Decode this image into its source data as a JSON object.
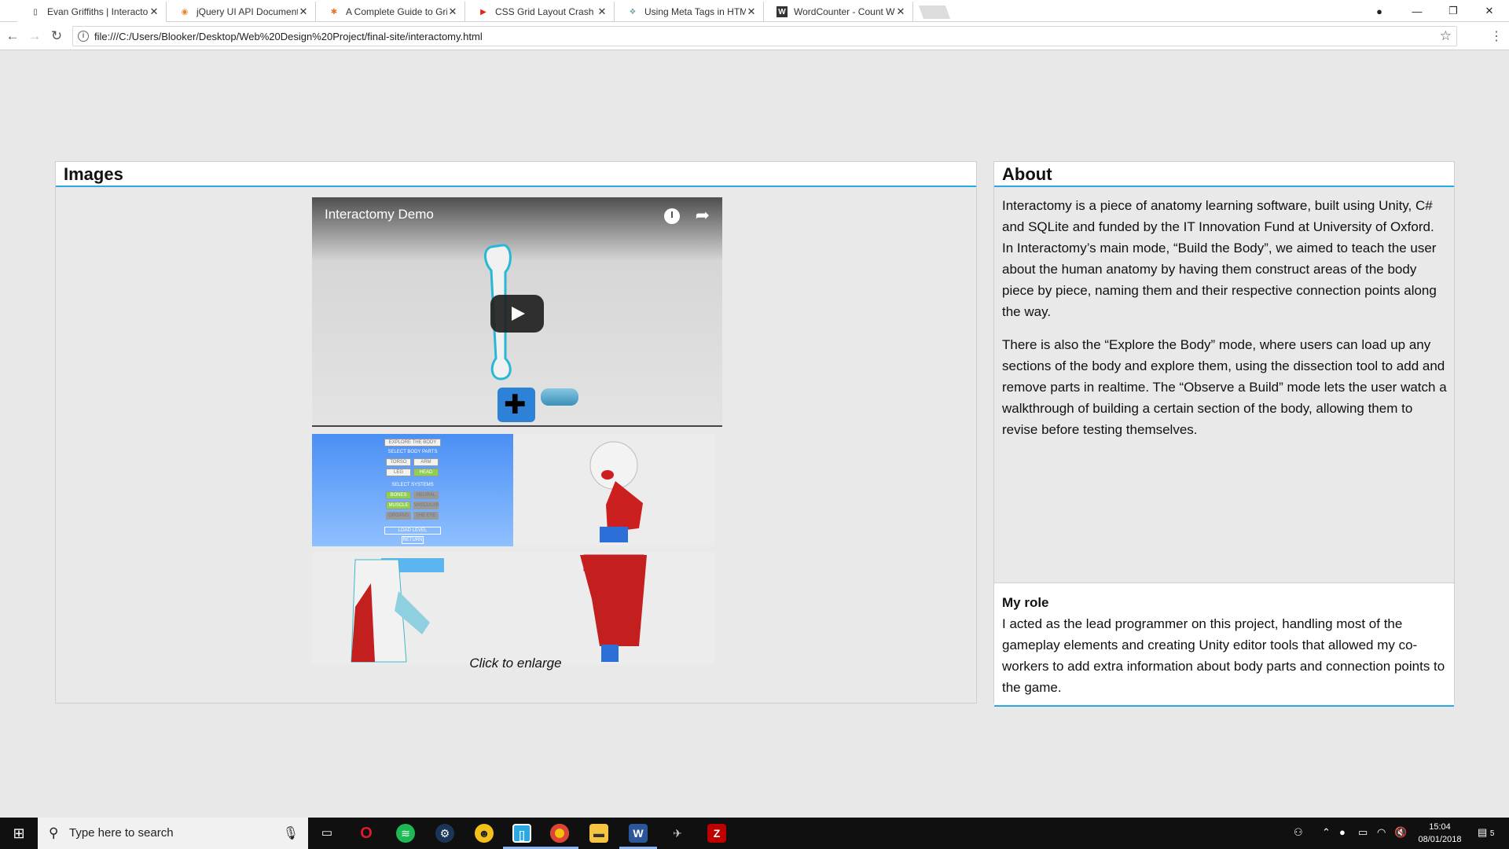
{
  "browser": {
    "tabs": [
      {
        "title": "Evan Griffiths | Interacto",
        "icon": "document-icon",
        "active": true
      },
      {
        "title": "jQuery UI API Document",
        "icon": "jquery-icon",
        "active": false
      },
      {
        "title": "A Complete Guide to Gri",
        "icon": "css-tricks-icon",
        "active": false
      },
      {
        "title": "CSS Grid Layout Crash C",
        "icon": "youtube-icon",
        "active": false
      },
      {
        "title": "Using Meta Tags in HTM",
        "icon": "meta-icon",
        "active": false
      },
      {
        "title": "WordCounter - Count W",
        "icon": "wordcounter-icon",
        "active": false
      }
    ],
    "url": "file:///C:/Users/Blooker/Desktop/Web%20Design%20Project/final-site/interactomy.html"
  },
  "images_section": {
    "heading": "Images",
    "video_title": "Interactomy Demo",
    "caption": "Click to enlarge",
    "thumb1": {
      "title": "EXPLORE THE BODY",
      "select_parts": "SELECT BODY PARTS",
      "parts": [
        "TORSO",
        "ARM",
        "LEG",
        "HEAD"
      ],
      "select_systems": "SELECT SYSTEMS",
      "systems": [
        "BONES",
        "NEURAL",
        "MUSCLE",
        "VASCULAR",
        "ORGANS",
        "THE EYE"
      ],
      "load": "LOAD LEVEL",
      "return": "RETURN"
    }
  },
  "about": {
    "heading": "About",
    "paragraphs": [
      "Interactomy is a piece of anatomy learning software, built using Unity, C# and SQLite and funded by the IT Innovation Fund at University of Oxford. In Interactomy’s main mode, “Build the Body”, we aimed to teach the user about the human anatomy by having them construct areas of the body piece by piece, naming them and their respective connection points along the way.",
      "There is also the “Explore the Body” mode, where users can load up any sections of the body and explore them, using the dissection tool to add and remove parts in realtime. The “Observe a Build” mode lets the user watch a walkthrough of building a certain section of the body, allowing them to revise before testing themselves."
    ],
    "role_heading": "My role",
    "role_text": "I acted as the lead programmer on this project, handling most of the gameplay elements and creating Unity editor tools that allowed my co-workers to add extra information about body parts and connection points to the game."
  },
  "taskbar": {
    "search_placeholder": "Type here to search",
    "time": "15:04",
    "date": "08/01/2018",
    "notification_count": "5"
  },
  "colors": {
    "accent": "#29a9e0",
    "page_bg": "#e8e8e8",
    "taskbar": "#101010"
  }
}
